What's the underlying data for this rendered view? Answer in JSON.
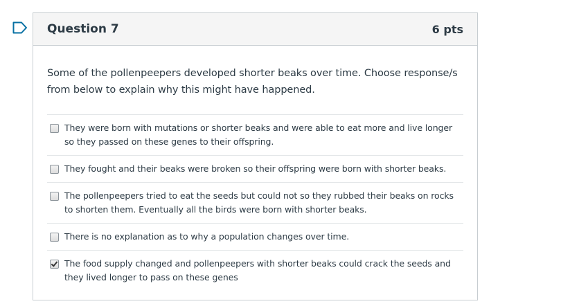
{
  "question": {
    "title": "Question 7",
    "points": "6 pts",
    "text": "Some of the pollenpeepers developed shorter beaks over time.  Choose response/s from below to explain why this might have happened.",
    "answers": [
      {
        "label": "They were born with mutations or shorter beaks and were able to eat more and live longer so they passed on these genes to their offspring.",
        "checked": false
      },
      {
        "label": "They fought and their beaks were broken so their offspring were born with shorter beaks.",
        "checked": false
      },
      {
        "label": "The pollenpeepers tried to eat the seeds but could not so they rubbed their beaks on rocks to shorten them. Eventually all the birds were born with shorter beaks.",
        "checked": false
      },
      {
        "label": "There is no explanation as to why a population changes over time.",
        "checked": false
      },
      {
        "label": "The food supply changed and pollenpeepers with shorter beaks could crack the seeds and they lived longer to pass on these genes",
        "checked": true
      }
    ]
  },
  "colors": {
    "flag_outline": "#0770a3",
    "header_bg": "#f5f5f5",
    "border": "#c7cdd1",
    "text": "#2d3b45"
  },
  "icons": {
    "flag": "flag-question-icon"
  }
}
